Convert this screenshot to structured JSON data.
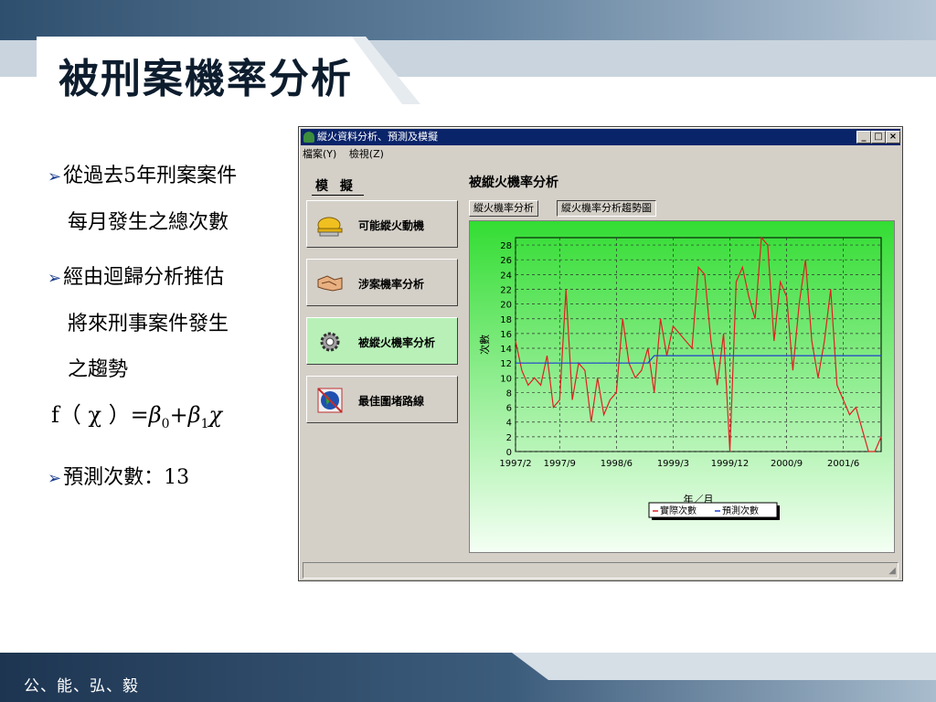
{
  "slide": {
    "title": "被刑案機率分析",
    "footer": "公、能、弘、毅"
  },
  "bullets": {
    "b1_line1": "從過去5年刑案案件",
    "b1_line2": "每月發生之總次數",
    "b2_line1": "經由迴歸分析推估",
    "b2_line2": "將來刑事案件發生",
    "b2_line3": "之趨勢",
    "formula_lhs": "f（ χ ）=",
    "formula_b0": "β",
    "formula_sub0": "0",
    "formula_plus": "+",
    "formula_b1": "β",
    "formula_sub1": "1",
    "formula_chi": "χ",
    "b3": "預測次數：13",
    "arrow_glyph": "➢"
  },
  "app": {
    "window_title": "縱火資料分析、預測及模擬",
    "menu_file": "檔案(Y)",
    "menu_view": "檢視(Z)",
    "btn_min": "_",
    "btn_max": "□",
    "btn_close": "×",
    "sidebar_heading": "模 擬",
    "sidebar_items": [
      {
        "label": "可能縱火動機",
        "icon": "hardhat-icon"
      },
      {
        "label": "涉案機率分析",
        "icon": "handshake-icon"
      },
      {
        "label": "被縱火機率分析",
        "icon": "gear-icon"
      },
      {
        "label": "最佳圍堵路線",
        "icon": "globe-icon"
      }
    ],
    "panel_title": "被縱火機率分析",
    "tabs": [
      "縱火機率分析",
      "縱火機率分析趨勢圖"
    ],
    "active_tab": 1,
    "accent_color": "#0a246a",
    "plot_bg_top": "#33dd33",
    "plot_bg_bottom": "#f4fff4"
  },
  "chart_data": {
    "type": "line",
    "xlabel": "年／月",
    "ylabel": "次數",
    "ylim": [
      0,
      29
    ],
    "yticks": [
      0,
      2,
      4,
      6,
      8,
      10,
      12,
      14,
      16,
      18,
      20,
      22,
      24,
      26,
      28
    ],
    "xtick_labels": [
      "1997/2",
      "1997/9",
      "1998/6",
      "1999/3",
      "1999/12",
      "2000/9",
      "2001/6"
    ],
    "xtick_index": [
      0,
      7,
      16,
      25,
      34,
      43,
      52
    ],
    "n_points": 59,
    "grid": true,
    "legend_position": "bottom-center",
    "series": [
      {
        "name": "實際次數",
        "color": "#e02020",
        "values": [
          15,
          11,
          9,
          10,
          9,
          13,
          6,
          7,
          22,
          7,
          12,
          11,
          4,
          10,
          5,
          7,
          8,
          18,
          12,
          10,
          11,
          14,
          8,
          18,
          13,
          17,
          16,
          15,
          14,
          25,
          24,
          15,
          9,
          16,
          0,
          23,
          25,
          21,
          18,
          29,
          28,
          15,
          23,
          21,
          11,
          20,
          26,
          15,
          10,
          15,
          22,
          9,
          7,
          5,
          6,
          3,
          0,
          0,
          2
        ]
      },
      {
        "name": "預測次數",
        "color": "#2040d0",
        "values": [
          12,
          12,
          12,
          12,
          12,
          12,
          12,
          12,
          12,
          12,
          12,
          12,
          12,
          12,
          12,
          12,
          12,
          12,
          12,
          12,
          12,
          12,
          13,
          13,
          13,
          13,
          13,
          13,
          13,
          13,
          13,
          13,
          13,
          13,
          13,
          13,
          13,
          13,
          13,
          13,
          13,
          13,
          13,
          13,
          13,
          13,
          13,
          13,
          13,
          13,
          13,
          13,
          13,
          13,
          13,
          13,
          13,
          13,
          13
        ]
      }
    ]
  }
}
